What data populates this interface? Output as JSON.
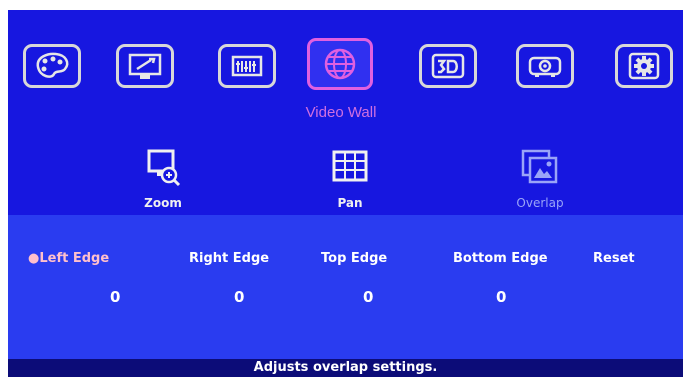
{
  "menu": {
    "title": "Video Wall",
    "tabs": [
      {
        "icon": "palette-icon",
        "active": false
      },
      {
        "icon": "display-settings-icon",
        "active": false
      },
      {
        "icon": "equalizer-icon",
        "active": false
      },
      {
        "icon": "globe-icon",
        "active": true
      },
      {
        "icon": "3d-icon",
        "active": false
      },
      {
        "icon": "projector-icon",
        "active": false
      },
      {
        "icon": "gear-icon",
        "active": false
      }
    ]
  },
  "submenu": {
    "items": [
      {
        "label": "Zoom",
        "icon": "zoom-monitor-icon",
        "active": true
      },
      {
        "label": "Pan",
        "icon": "pan-grid-icon",
        "active": true
      },
      {
        "label": "Overlap",
        "icon": "overlap-image-icon",
        "active": false
      }
    ]
  },
  "options": {
    "labels": [
      "●Left Edge",
      "Right Edge",
      "Top Edge",
      "Bottom Edge",
      "Reset"
    ],
    "values": [
      "0",
      "0",
      "0",
      "0"
    ]
  },
  "help": {
    "text": "Adjusts overlap settings."
  },
  "colors": {
    "background": "#1a1ae6",
    "accent": "#e060e0",
    "selected": "#ffc0cc",
    "help_bar": "#0c0c78"
  }
}
